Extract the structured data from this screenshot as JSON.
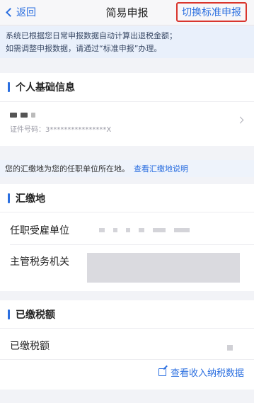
{
  "nav": {
    "back_label": "返回",
    "title": "简易申报",
    "switch_label": "切换标准申报"
  },
  "notice": {
    "line1": "系统已根据您日常申报数据自动计算出退税金额；",
    "line2": "如需调整申报数据，请通过“标准申报”办理。"
  },
  "personal": {
    "section_title": "个人基础信息",
    "id_label": "证件号码：",
    "id_value": "3****************X"
  },
  "info_strip": {
    "text": "您的汇缴地为您的任职单位所在地。",
    "link": "查看汇缴地说明"
  },
  "payment_location": {
    "section_title": "汇缴地",
    "employer_label": "任职受雇单位",
    "tax_authority_label": "主管税务机关"
  },
  "tax_paid": {
    "section_title": "已缴税额",
    "row_label": "已缴税额",
    "view_link": "查看收入纳税数据"
  },
  "colors": {
    "accent": "#2b6fe0",
    "highlight_border": "#d9352d"
  },
  "icons": [
    "chevron-left-icon",
    "chevron-right-icon",
    "edit-icon"
  ]
}
